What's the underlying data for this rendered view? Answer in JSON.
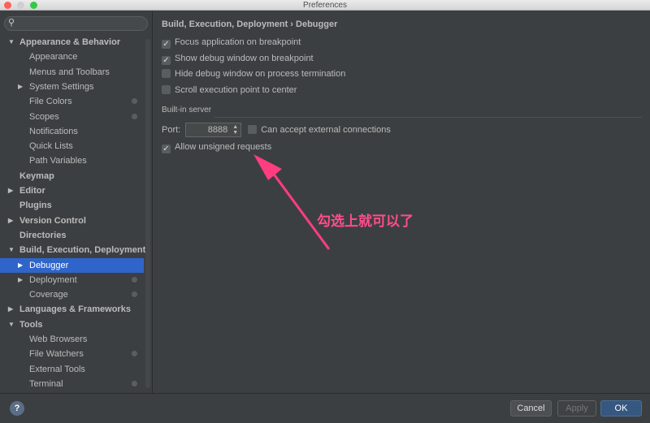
{
  "window": {
    "title": "Preferences"
  },
  "search": {
    "placeholder": ""
  },
  "sidebar": {
    "items": [
      {
        "label": "Appearance & Behavior",
        "level": 0,
        "bold": true,
        "expanded": true
      },
      {
        "label": "Appearance",
        "level": 1
      },
      {
        "label": "Menus and Toolbars",
        "level": 1
      },
      {
        "label": "System Settings",
        "level": 1,
        "collapsed": true
      },
      {
        "label": "File Colors",
        "level": 1,
        "gear": true
      },
      {
        "label": "Scopes",
        "level": 1,
        "gear": true
      },
      {
        "label": "Notifications",
        "level": 1
      },
      {
        "label": "Quick Lists",
        "level": 1
      },
      {
        "label": "Path Variables",
        "level": 1
      },
      {
        "label": "Keymap",
        "level": 0,
        "bold": true
      },
      {
        "label": "Editor",
        "level": 0,
        "bold": true,
        "collapsed": true
      },
      {
        "label": "Plugins",
        "level": 0,
        "bold": true
      },
      {
        "label": "Version Control",
        "level": 0,
        "bold": true,
        "collapsed": true
      },
      {
        "label": "Directories",
        "level": 0,
        "bold": true
      },
      {
        "label": "Build, Execution, Deployment",
        "level": 0,
        "bold": true,
        "expanded": true
      },
      {
        "label": "Debugger",
        "level": 1,
        "collapsed": true,
        "selected": true
      },
      {
        "label": "Deployment",
        "level": 1,
        "collapsed": true,
        "gear": true
      },
      {
        "label": "Coverage",
        "level": 1,
        "gear": true
      },
      {
        "label": "Languages & Frameworks",
        "level": 0,
        "bold": true,
        "collapsed": true
      },
      {
        "label": "Tools",
        "level": 0,
        "bold": true,
        "expanded": true
      },
      {
        "label": "Web Browsers",
        "level": 1
      },
      {
        "label": "File Watchers",
        "level": 1,
        "gear": true
      },
      {
        "label": "External Tools",
        "level": 1
      },
      {
        "label": "Terminal",
        "level": 1,
        "gear": true
      }
    ]
  },
  "main": {
    "breadcrumb": "Build, Execution, Deployment › Debugger",
    "options": [
      {
        "label": "Focus application on breakpoint",
        "checked": true
      },
      {
        "label": "Show debug window on breakpoint",
        "checked": true
      },
      {
        "label": "Hide debug window on process termination",
        "checked": false
      },
      {
        "label": "Scroll execution point to center",
        "checked": false
      }
    ],
    "server_section": "Built-in server",
    "port_label": "Port:",
    "port_value": "8888",
    "external_label": "Can accept external connections",
    "external_checked": false,
    "unsigned_label": "Allow unsigned requests",
    "unsigned_checked": true
  },
  "annotation": {
    "text": "勾选上就可以了",
    "color": "#ff3d7f"
  },
  "footer": {
    "help": "?",
    "cancel": "Cancel",
    "apply": "Apply",
    "ok": "OK"
  },
  "colors": {
    "selection": "#2f65ca",
    "background": "#3c3f41"
  }
}
